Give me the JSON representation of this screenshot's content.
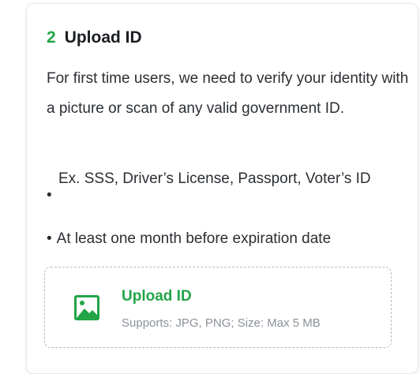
{
  "step": {
    "number": "2",
    "title": "Upload ID"
  },
  "description": "For first time users, we need to verify your identity with a picture or scan of any valid government ID.",
  "bullets": [
    "Ex. SSS, Driver’s License, Passport, Voter’s ID",
    "At least one month before expiration date"
  ],
  "bullet_symbol": "•",
  "upload": {
    "title": "Upload ID",
    "subtitle": "Supports: JPG, PNG; Size: Max 5 MB",
    "icon": "image-icon"
  },
  "colors": {
    "accent": "#22a447",
    "text": "#2b2f33",
    "muted": "#8b9299",
    "dashed_border": "#b5bcc3"
  }
}
